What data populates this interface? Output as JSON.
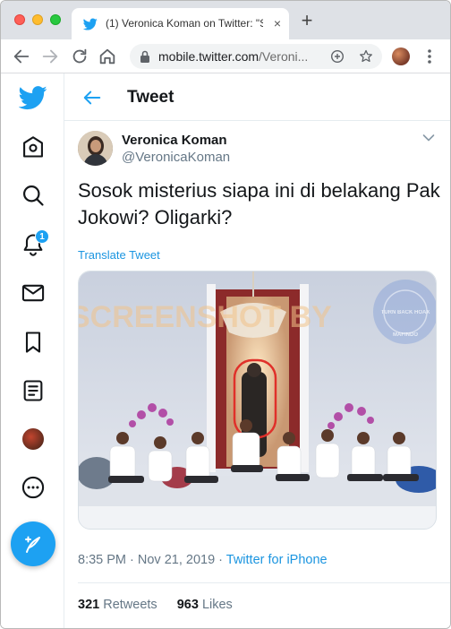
{
  "browser": {
    "tab_title": "(1) Veronica Koman on Twitter: \"S",
    "url_domain": "mobile.twitter.com",
    "url_path": "/Veroni...",
    "colors": {
      "tabbar": "#dee1e6",
      "omnibox": "#f1f3f4"
    }
  },
  "sidebar": {
    "items": [
      {
        "icon": "home-icon"
      },
      {
        "icon": "search-icon"
      },
      {
        "icon": "notifications-icon",
        "badge": "1"
      },
      {
        "icon": "messages-icon"
      },
      {
        "icon": "bookmarks-icon"
      },
      {
        "icon": "lists-icon"
      },
      {
        "icon": "profile-avatar"
      },
      {
        "icon": "more-icon"
      }
    ],
    "compose_icon": "compose-tweet-icon"
  },
  "header": {
    "title": "Tweet"
  },
  "tweet": {
    "author_name": "Veronica Koman",
    "author_handle": "@VeronicaKoman",
    "text": "Sosok misterius siapa ini di belakang Pak Jokowi? Oligarki?",
    "translate_label": "Translate Tweet",
    "image_overlays": {
      "watermark": "SCREENSHOT BY",
      "badge_text": "TURN BACK HOAX",
      "badge_subtext": "MAFINDO"
    },
    "time": "8:35 PM",
    "date": "Nov 21, 2019",
    "source": "Twitter for iPhone",
    "retweets_count": "321",
    "retweets_label": "Retweets",
    "likes_count": "963",
    "likes_label": "Likes"
  },
  "theme": {
    "accent": "#1da1f2",
    "link": "#1b95e0",
    "text": "#14171a",
    "secondary": "#657786"
  }
}
